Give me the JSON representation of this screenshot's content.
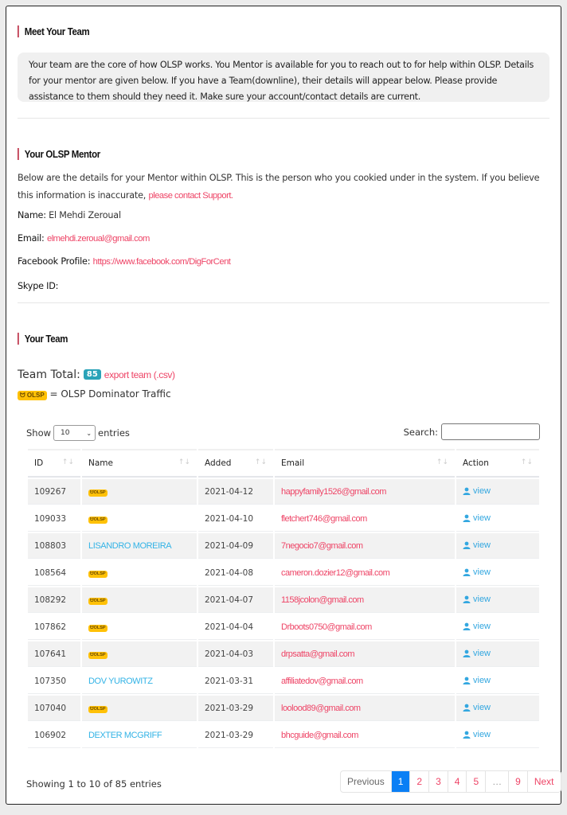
{
  "sections": {
    "meet_team": {
      "title": "Meet Your Team",
      "intro": "Your team are the core of how OLSP works. You Mentor is available for you to reach out to for help within OLSP. Details for your mentor are given below. If you have a Team(downline), their details will appear below. Please provide assistance to them should they need it. Make sure your account/contact details are current."
    },
    "mentor": {
      "title": "Your OLSP Mentor",
      "description": "Below are the details for your Mentor within OLSP. This is the person who you cookied under in the system. If you believe this information is inaccurate,",
      "support_link": "please contact Support.",
      "name_label": "Name:",
      "name_value": "El Mehdi Zeroual",
      "email_label": "Email:",
      "email_value": "elmehdi.zeroual@gmail.com",
      "facebook_label": "Facebook Profile:",
      "facebook_value": "https://www.facebook.com/DigForCent",
      "skype_label": "Skype ID:",
      "skype_value": ""
    },
    "team": {
      "title": "Your Team",
      "total_label": "Team Total:",
      "total_value": "85",
      "export_link": "export team (.csv)",
      "badge_label": "OLSP",
      "legend_text": "= OLSP Dominator Traffic"
    }
  },
  "table_controls": {
    "show_label": "Show",
    "entries_value": "10",
    "entries_label": "entries",
    "search_label": "Search:",
    "search_value": ""
  },
  "table": {
    "columns": [
      "ID",
      "Name",
      "Added",
      "Email",
      "Action"
    ],
    "rows": [
      {
        "id": "109267",
        "name": "",
        "olsp": true,
        "added": "2021-04-12",
        "email": "happyfamily1526@gmail.com",
        "action": "view"
      },
      {
        "id": "109033",
        "name": "",
        "olsp": true,
        "added": "2021-04-10",
        "email": "fletchert746@gmail.com",
        "action": "view"
      },
      {
        "id": "108803",
        "name": "LISANDRO MOREIRA",
        "olsp": false,
        "added": "2021-04-09",
        "email": "7negocio7@gmail.com",
        "action": "view"
      },
      {
        "id": "108564",
        "name": "",
        "olsp": true,
        "added": "2021-04-08",
        "email": "cameron.dozier12@gmail.com",
        "action": "view"
      },
      {
        "id": "108292",
        "name": "",
        "olsp": true,
        "added": "2021-04-07",
        "email": "1158jcolon@gmail.com",
        "action": "view"
      },
      {
        "id": "107862",
        "name": "",
        "olsp": true,
        "added": "2021-04-04",
        "email": "Drboots0750@gmail.com",
        "action": "view"
      },
      {
        "id": "107641",
        "name": "",
        "olsp": true,
        "added": "2021-04-03",
        "email": "drpsatta@gmail.com",
        "action": "view"
      },
      {
        "id": "107350",
        "name": "DOV YUROWITZ",
        "olsp": false,
        "added": "2021-03-31",
        "email": "affiliatedov@gmail.com",
        "action": "view"
      },
      {
        "id": "107040",
        "name": "",
        "olsp": true,
        "added": "2021-03-29",
        "email": "loolood89@gmail.com",
        "action": "view"
      },
      {
        "id": "106902",
        "name": "DEXTER MCGRIFF",
        "olsp": false,
        "added": "2021-03-29",
        "email": "bhcguide@gmail.com",
        "action": "view"
      }
    ]
  },
  "footer": {
    "info": "Showing 1 to 10 of 85 entries",
    "pagination": [
      "Previous",
      "1",
      "2",
      "3",
      "4",
      "5",
      "…",
      "9",
      "Next"
    ],
    "active_page": "1"
  },
  "colors": {
    "accent_pink": "#ee4466",
    "link_blue": "#33b3e6",
    "section_bar": "#c0394f",
    "badge_teal": "#2aa3b8",
    "olsp_yellow": "#ffc107",
    "active_page": "#0a7ff5"
  }
}
